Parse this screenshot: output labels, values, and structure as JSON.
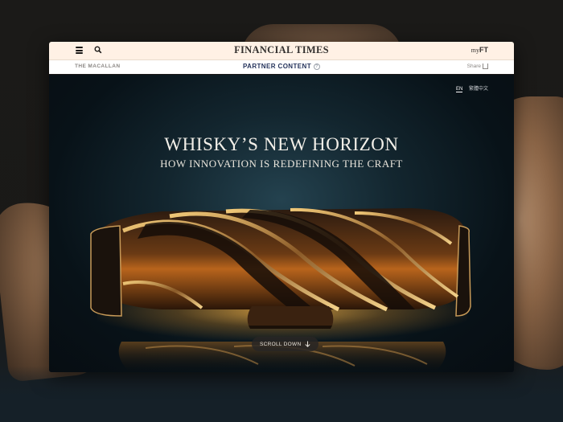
{
  "header": {
    "brand": "FINANCIAL TIMES",
    "myft_prefix": "my",
    "myft_suffix": "FT"
  },
  "subbar": {
    "sponsor": "THE MACALLAN",
    "section": "PARTNER CONTENT",
    "help": "?",
    "share": "Share"
  },
  "hero": {
    "lang_en": "EN",
    "lang_zh": "繁體中文",
    "title": "WHISKY’S NEW HORIZON",
    "subtitle": "HOW INNOVATION IS REDEFINING THE CRAFT",
    "scroll_label": "SCROLL DOWN"
  },
  "icons": {
    "menu": "hamburger-icon",
    "search": "search-icon",
    "share": "share-icon",
    "scroll": "arrow-down-icon"
  }
}
